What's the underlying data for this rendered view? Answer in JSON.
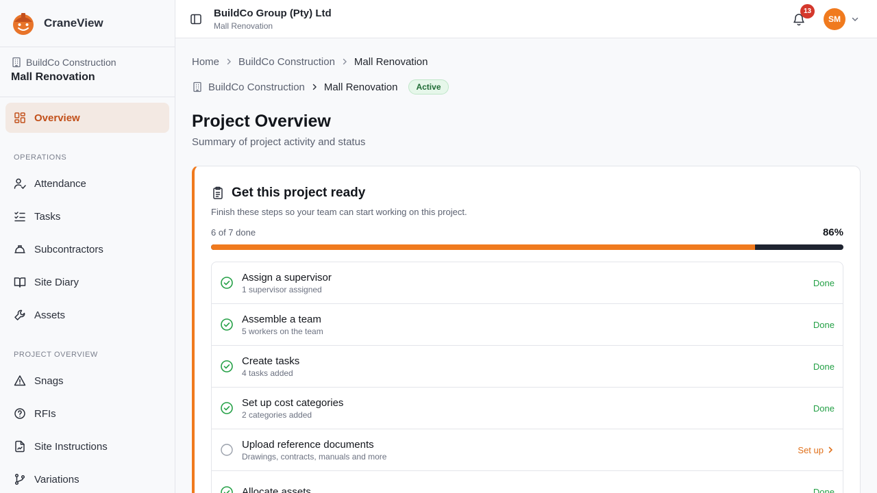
{
  "app": {
    "name": "CraneView"
  },
  "sidebar": {
    "org": "BuildCo Construction",
    "project": "Mall Renovation",
    "overview": "Overview",
    "sections": {
      "operations": "OPERATIONS",
      "project_overview": "PROJECT OVERVIEW"
    },
    "operations": [
      {
        "label": "Attendance",
        "icon": "user-check-icon"
      },
      {
        "label": "Tasks",
        "icon": "list-checks-icon"
      },
      {
        "label": "Subcontractors",
        "icon": "hard-hat-icon"
      },
      {
        "label": "Site Diary",
        "icon": "book-icon"
      },
      {
        "label": "Assets",
        "icon": "wrench-icon"
      }
    ],
    "project_overview": [
      {
        "label": "Snags",
        "icon": "alert-triangle-icon"
      },
      {
        "label": "RFIs",
        "icon": "help-circle-icon"
      },
      {
        "label": "Site Instructions",
        "icon": "file-signature-icon"
      },
      {
        "label": "Variations",
        "icon": "git-branch-icon"
      }
    ]
  },
  "topbar": {
    "org_title": "BuildCo Group (Pty) Ltd",
    "org_sub": "Mall Renovation",
    "notifications": "13",
    "avatar_initials": "SM"
  },
  "breadcrumb": {
    "items": [
      "Home",
      "BuildCo Construction"
    ],
    "current": "Mall Renovation"
  },
  "project_crumb": {
    "org": "BuildCo Construction",
    "project": "Mall Renovation",
    "status": "Active"
  },
  "page": {
    "title": "Project Overview",
    "subtitle": "Summary of project activity and status"
  },
  "setup_card": {
    "title": "Get this project ready",
    "description": "Finish these steps so your team can start working on this project.",
    "progress_label": "6 of 7 done",
    "progress_percent_label": "86%",
    "progress_fraction": 0.86,
    "steps": [
      {
        "title": "Assign a supervisor",
        "subtitle": "1 supervisor assigned",
        "status": "Done",
        "done": true
      },
      {
        "title": "Assemble a team",
        "subtitle": "5 workers on the team",
        "status": "Done",
        "done": true
      },
      {
        "title": "Create tasks",
        "subtitle": "4 tasks added",
        "status": "Done",
        "done": true
      },
      {
        "title": "Set up cost categories",
        "subtitle": "2 categories added",
        "status": "Done",
        "done": true
      },
      {
        "title": "Upload reference documents",
        "subtitle": "Drawings, contracts, manuals and more",
        "status": "Set up",
        "done": false
      },
      {
        "title": "Allocate assets",
        "subtitle": "",
        "status": "Done",
        "done": true
      }
    ]
  },
  "colors": {
    "accent": "#f07a1e",
    "success": "#24a046",
    "active_nav_bg": "#f3e9e3",
    "active_nav_text": "#c2501a"
  }
}
